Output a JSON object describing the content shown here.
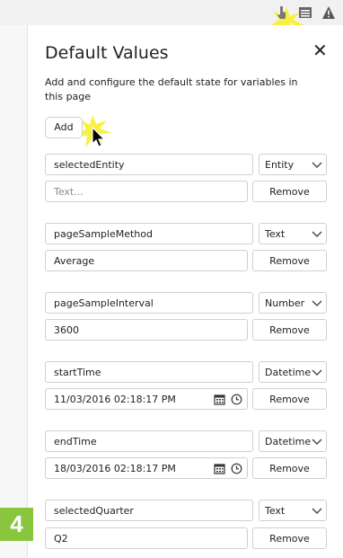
{
  "toolbar": {
    "icons": [
      "hand-pointer-icon",
      "list-window-icon",
      "warning-icon"
    ]
  },
  "panel": {
    "title": "Default Values",
    "close_label": "✕",
    "description": "Add and configure the default state for variables in this page",
    "add_label": "Add"
  },
  "variables": [
    {
      "name": "selectedEntity",
      "type": "Entity",
      "value": "",
      "value_placeholder": "Text...",
      "remove_label": "Remove"
    },
    {
      "name": "pageSampleMethod",
      "type": "Text",
      "value": "Average",
      "remove_label": "Remove"
    },
    {
      "name": "pageSampleInterval",
      "type": "Number",
      "value": "3600",
      "remove_label": "Remove"
    },
    {
      "name": "startTime",
      "type": "Datetime",
      "value": "11/03/2016 02:18:17 PM",
      "remove_label": "Remove"
    },
    {
      "name": "endTime",
      "type": "Datetime",
      "value": "18/03/2016 02:18:17 PM",
      "remove_label": "Remove"
    },
    {
      "name": "selectedQuarter",
      "type": "Text",
      "value": "Q2",
      "remove_label": "Remove"
    }
  ],
  "step_badge": "4",
  "colors": {
    "badge": "#8ac53e",
    "highlight": "#f7ef2b"
  }
}
